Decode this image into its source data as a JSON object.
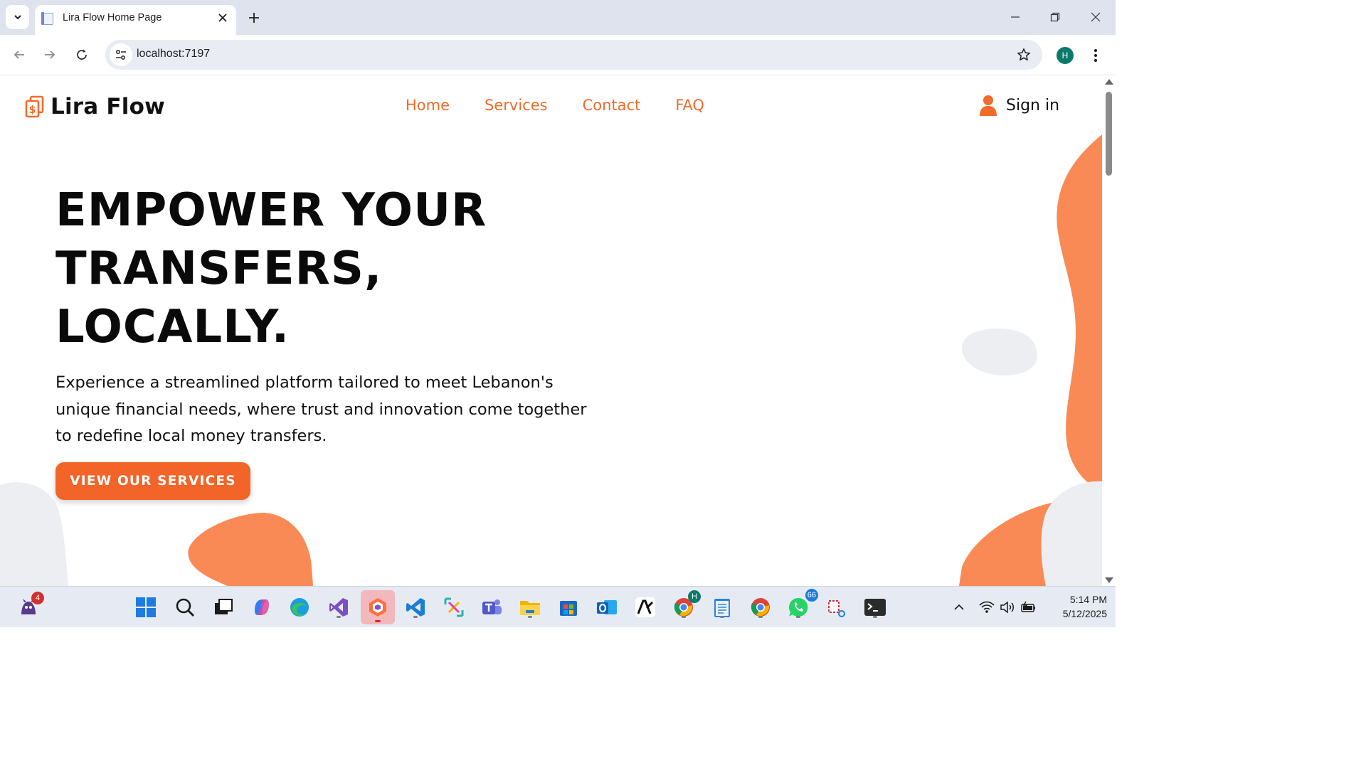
{
  "browser": {
    "tab_title": "Lira Flow Home Page",
    "url": "localhost:7197",
    "profile_initial": "H"
  },
  "site": {
    "brand": "Lira Flow",
    "nav": [
      {
        "label": "Home"
      },
      {
        "label": "Services"
      },
      {
        "label": "Contact"
      },
      {
        "label": "FAQ"
      }
    ],
    "sign_in": "Sign in",
    "hero": {
      "title_lines": [
        "EMPOWER YOUR",
        "TRANSFERS,",
        "LOCALLY."
      ],
      "text": "Experience a streamlined platform tailored to meet Lebanon's unique financial needs, where trust and innovation come together to redefine local money transfers.",
      "cta": "VIEW OUR SERVICES"
    },
    "colors": {
      "accent": "#f26b2a",
      "blob_orange": "#f98a55",
      "blob_gray": "#eceef2"
    }
  },
  "taskbar": {
    "notif_badge": "4",
    "chrome_profile_badge": "H",
    "whatsapp_badge": "66",
    "time": "5:14 PM",
    "date": "5/12/2025",
    "icons": [
      "start",
      "search",
      "task-view",
      "copilot",
      "edge",
      "visual-studio",
      "app-cube",
      "vscode",
      "snipping",
      "teams",
      "file-explorer",
      "ms-store",
      "outlook",
      "text-app",
      "chrome-profile",
      "notepad",
      "chrome",
      "whatsapp",
      "paint-tool",
      "terminal"
    ]
  }
}
